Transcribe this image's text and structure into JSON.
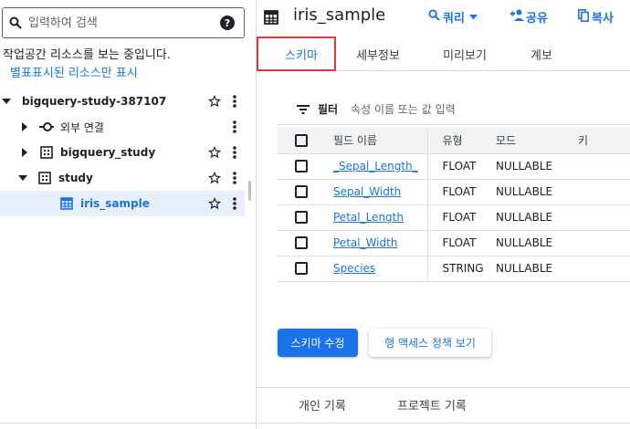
{
  "search": {
    "placeholder": "입력하여 검색",
    "help_label": "?"
  },
  "workspace": {
    "notice": "작업공간 리소스를 보는 중입니다.",
    "starred_link": "별표표시된 리소스만 표시"
  },
  "tree": {
    "project": "bigquery-study-387107",
    "external": "외부 연결",
    "dataset1": "bigquery_study",
    "dataset2": "study",
    "table": "iris_sample"
  },
  "header": {
    "title": "iris_sample",
    "query_label": "쿼리",
    "share_label": "공유",
    "copy_label": "복사"
  },
  "tabs": [
    "스키마",
    "세부정보",
    "미리보기",
    "계보"
  ],
  "filter": {
    "label": "필터",
    "placeholder": "속성 이름 또는 값 입력"
  },
  "schema": {
    "columns": [
      "필드 이름",
      "유형",
      "모드",
      "키"
    ],
    "rows": [
      {
        "name": "_Sepal_Length_",
        "type": "FLOAT",
        "mode": "NULLABLE"
      },
      {
        "name": "Sepal_Width",
        "type": "FLOAT",
        "mode": "NULLABLE"
      },
      {
        "name": "Petal_Length",
        "type": "FLOAT",
        "mode": "NULLABLE"
      },
      {
        "name": "Petal_Width",
        "type": "FLOAT",
        "mode": "NULLABLE"
      },
      {
        "name": "Species",
        "type": "STRING",
        "mode": "NULLABLE"
      }
    ]
  },
  "actions": {
    "edit_schema": "스키마 수정",
    "view_policies": "행 액세스 정책 보기"
  },
  "history": {
    "personal": "개인 기록",
    "project": "프로젝트 기록"
  },
  "colors": {
    "accent": "#1a73e8",
    "highlight": "#e53935",
    "selected_bg": "#e8f0fe"
  }
}
